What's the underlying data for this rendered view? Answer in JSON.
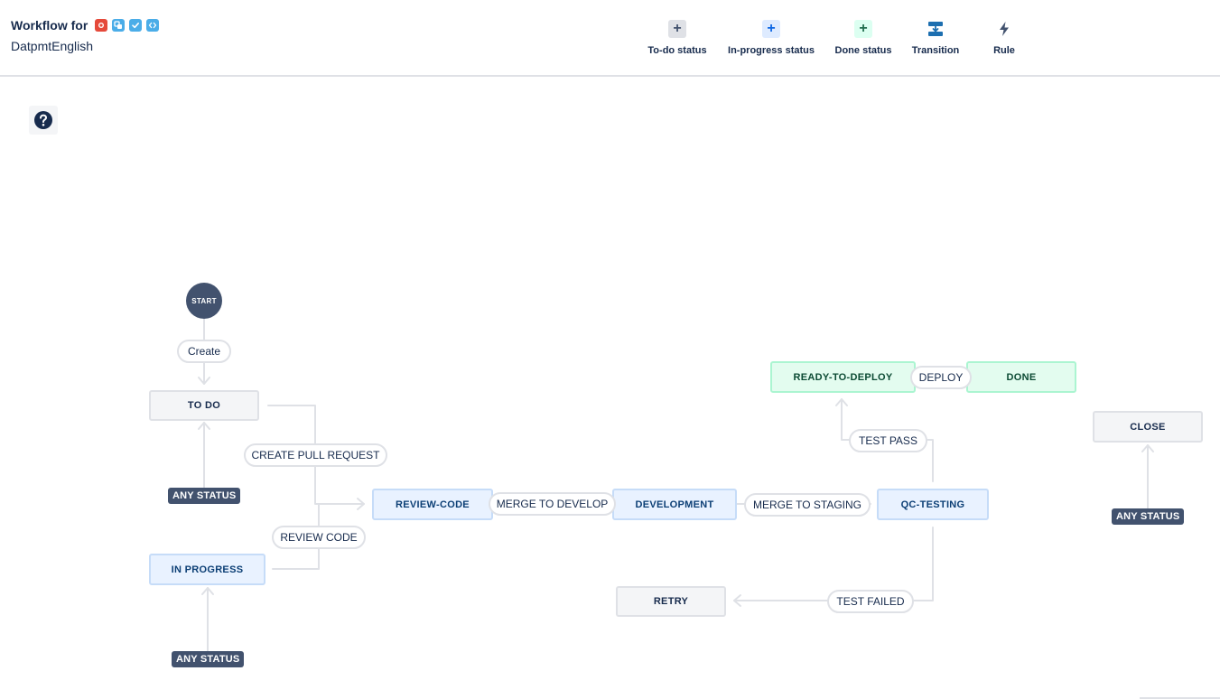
{
  "header": {
    "title": "Workflow for",
    "project": "DatpmtEnglish",
    "issue_type_icons": [
      {
        "name": "bug-icon",
        "color": "#e5493a"
      },
      {
        "name": "subtask-icon",
        "color": "#4bade8"
      },
      {
        "name": "task-icon",
        "color": "#4bade8"
      },
      {
        "name": "code-icon",
        "color": "#4bade8"
      }
    ]
  },
  "toolbar": {
    "todo_label": "To-do status",
    "inprogress_label": "In-progress status",
    "done_label": "Done status",
    "transition_label": "Transition",
    "rule_label": "Rule",
    "todo_icon": "+",
    "inprogress_icon": "+",
    "done_icon": "+"
  },
  "help": {
    "icon": "question-icon"
  },
  "statuses": {
    "start": "START",
    "todo": "TO DO",
    "in_progress": "IN PROGRESS",
    "review_code": "REVIEW-CODE",
    "development": "DEVELOPMENT",
    "qc_testing": "QC-TESTING",
    "ready_to_deploy": "READY-TO-DEPLOY",
    "done": "DONE",
    "retry": "RETRY",
    "close": "CLOSE"
  },
  "transitions": {
    "create": "Create",
    "create_pull_request": "CREATE PULL REQUEST",
    "review_code": "REVIEW CODE",
    "merge_to_develop": "MERGE TO DEVELOP",
    "merge_to_staging": "MERGE TO STAGING",
    "test_pass": "TEST PASS",
    "deploy": "DEPLOY",
    "test_failed": "TEST FAILED"
  },
  "any_status": {
    "todo": "ANY STATUS",
    "in_progress": "ANY STATUS",
    "close": "ANY STATUS"
  },
  "colors": {
    "todo_category": "#dfe1e6",
    "inprogress_category": "#deebff",
    "done_category": "#e3fcef",
    "badge": "#42526e",
    "transition_icon": "#1d6fb0"
  }
}
